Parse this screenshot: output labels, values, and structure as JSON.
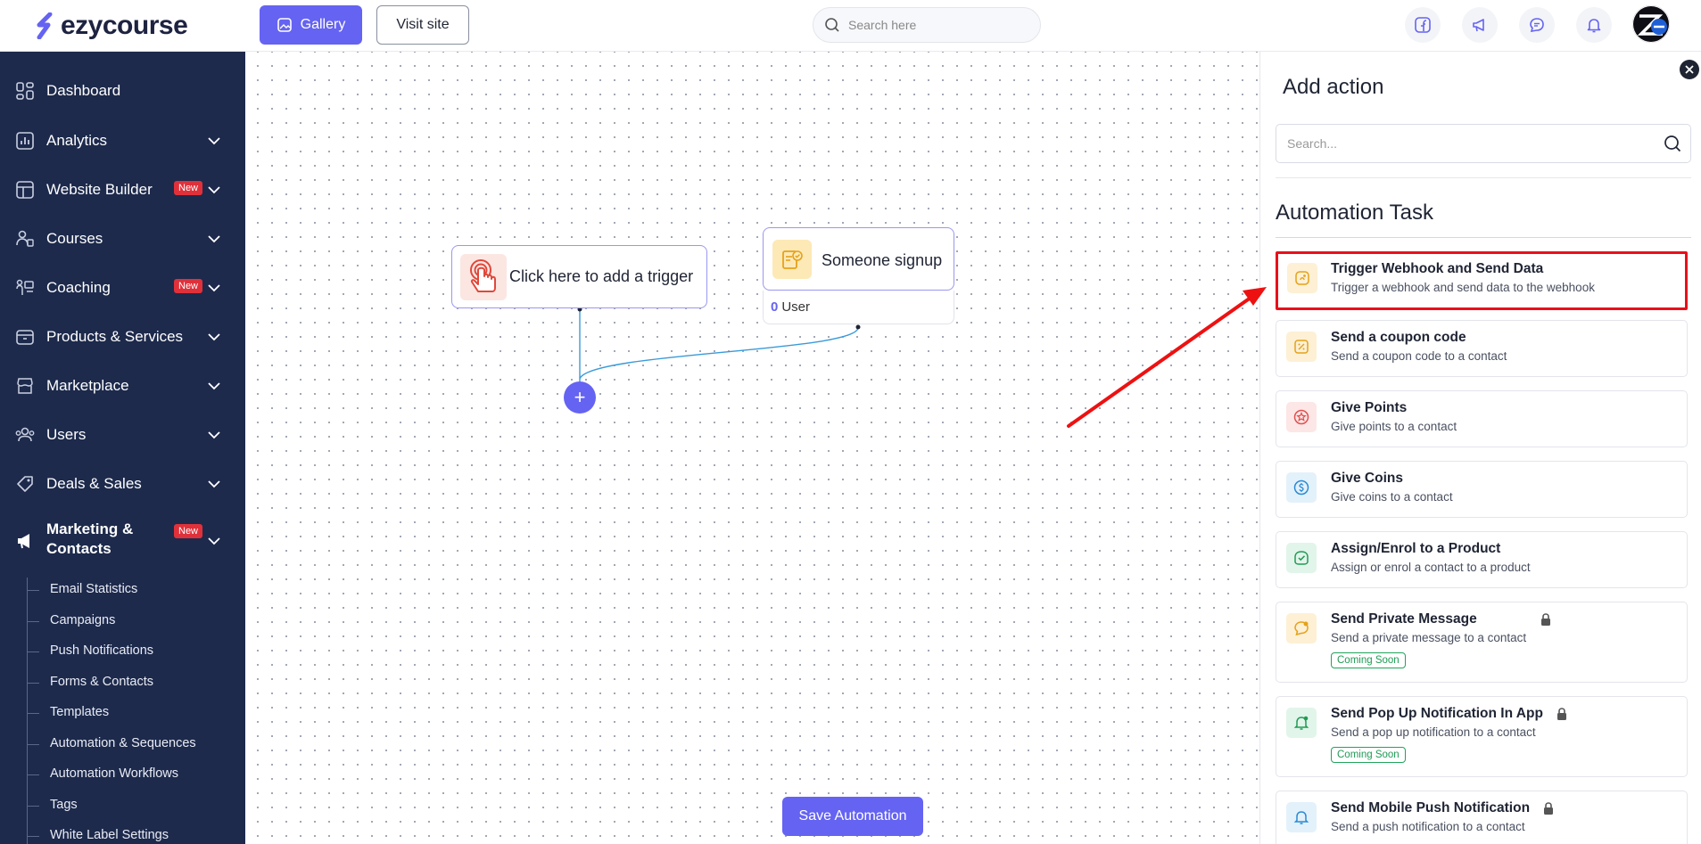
{
  "header": {
    "logo_text": "ezycourse",
    "gallery_label": "Gallery",
    "visit_label": "Visit site",
    "search_placeholder": "Search here",
    "icons": [
      "facebook-icon",
      "megaphone-icon",
      "chat-icon",
      "bell-icon"
    ]
  },
  "sidebar": {
    "items": [
      {
        "label": "Dashboard"
      },
      {
        "label": "Analytics"
      },
      {
        "label": "Website Builder",
        "badge": "New"
      },
      {
        "label": "Courses"
      },
      {
        "label": "Coaching",
        "badge": "New"
      },
      {
        "label": "Products & Services"
      },
      {
        "label": "Marketplace"
      },
      {
        "label": "Users"
      },
      {
        "label": "Deals & Sales"
      },
      {
        "label_line1": "Marketing &",
        "label_line2": "Contacts",
        "badge": "New"
      }
    ],
    "subitems": [
      "Email Statistics",
      "Campaigns",
      "Push Notifications",
      "Forms & Contacts",
      "Templates",
      "Automation & Sequences",
      "Automation Workflows",
      "Tags",
      "White Label Settings"
    ]
  },
  "canvas": {
    "trigger_label": "Click here to add a trigger",
    "signup_label": "Someone signup",
    "signup_count": "0",
    "signup_unit": "User",
    "add_symbol": "+",
    "save_label": "Save Automation"
  },
  "panel": {
    "title": "Add action",
    "search_placeholder": "Search...",
    "section_title": "Automation Task",
    "tasks": [
      {
        "title": "Trigger Webhook and Send Data",
        "desc": "Trigger a webhook and send data to the webhook",
        "highlighted": true,
        "color": "#fdf0d5"
      },
      {
        "title": "Send a coupon code",
        "desc": "Send a coupon code to a contact",
        "color": "#fdf0d5"
      },
      {
        "title": "Give Points",
        "desc": "Give points to a contact",
        "color": "#fde6e6"
      },
      {
        "title": "Give Coins",
        "desc": "Give coins to a contact",
        "color": "#e3f1fb"
      },
      {
        "title": "Assign/Enrol to a Product",
        "desc": "Assign or enrol a contact to a product",
        "color": "#e2f5ea"
      },
      {
        "title": "Send Private Message",
        "desc": "Send a private message to a contact",
        "badge": "Coming Soon",
        "locked": true,
        "color": "#fdf0d5"
      },
      {
        "title": "Send Pop Up Notification In App",
        "desc": "Send a pop up notification to a contact",
        "badge": "Coming Soon",
        "locked": true,
        "color": "#e2f5ea"
      },
      {
        "title": "Send Mobile Push Notification",
        "desc": "Send a push notification to a contact",
        "locked": true,
        "color": "#e3f1fb"
      }
    ]
  },
  "colors": {
    "accent": "#6563f2",
    "sidebar_bg": "#1d2a4c",
    "highlight": "#e8101a",
    "new_badge": "#e0313a"
  }
}
